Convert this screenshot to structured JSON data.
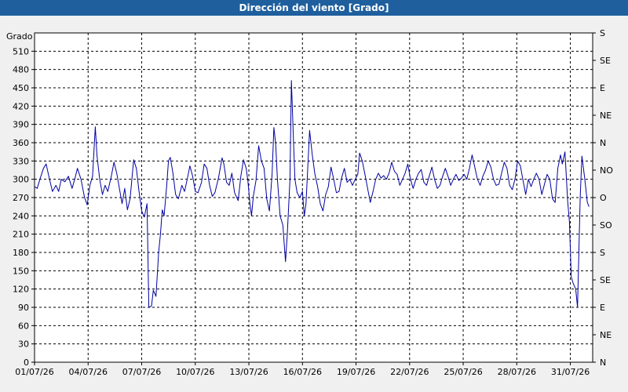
{
  "window": {
    "title": "Dirección del viento [Grado]"
  },
  "colors": {
    "title_bar": "#1f5f9e",
    "series": "#0000a0",
    "grid": "#000000",
    "background": "#ffffff"
  },
  "chart_data": {
    "type": "line",
    "title": "Dirección del viento [Grado]",
    "ylabel": "Grado",
    "xlim": [
      0,
      31.25
    ],
    "ylim": [
      0,
      540
    ],
    "x_ticks": [
      {
        "x": 0,
        "label": "01/07/26"
      },
      {
        "x": 3,
        "label": "04/07/26"
      },
      {
        "x": 6,
        "label": "07/07/26"
      },
      {
        "x": 9,
        "label": "10/07/26"
      },
      {
        "x": 12,
        "label": "13/07/26"
      },
      {
        "x": 15,
        "label": "16/07/26"
      },
      {
        "x": 18,
        "label": "19/07/26"
      },
      {
        "x": 21,
        "label": "22/07/26"
      },
      {
        "x": 24,
        "label": "25/07/26"
      },
      {
        "x": 27,
        "label": "28/07/26"
      },
      {
        "x": 30,
        "label": "31/07/26"
      }
    ],
    "y_ticks": [
      0,
      30,
      60,
      90,
      120,
      150,
      180,
      210,
      240,
      270,
      300,
      330,
      360,
      390,
      420,
      450,
      480,
      510
    ],
    "right_axis": [
      {
        "y": 540,
        "label": "S"
      },
      {
        "y": 495,
        "label": "SE"
      },
      {
        "y": 450,
        "label": "E"
      },
      {
        "y": 405,
        "label": "NE"
      },
      {
        "y": 360,
        "label": "N"
      },
      {
        "y": 315,
        "label": "NO"
      },
      {
        "y": 270,
        "label": "O"
      },
      {
        "y": 225,
        "label": "SO"
      },
      {
        "y": 180,
        "label": "S"
      },
      {
        "y": 135,
        "label": "SE"
      },
      {
        "y": 90,
        "label": "E"
      },
      {
        "y": 45,
        "label": "NE"
      },
      {
        "y": 0,
        "label": "N"
      }
    ],
    "grid": true,
    "series": [
      {
        "values": [
          [
            0,
            288
          ],
          [
            0.15,
            285
          ],
          [
            0.3,
            300
          ],
          [
            0.5,
            318
          ],
          [
            0.65,
            325
          ],
          [
            0.8,
            305
          ],
          [
            1.0,
            280
          ],
          [
            1.2,
            290
          ],
          [
            1.35,
            280
          ],
          [
            1.5,
            300
          ],
          [
            1.7,
            296
          ],
          [
            1.9,
            305
          ],
          [
            2.1,
            285
          ],
          [
            2.25,
            300
          ],
          [
            2.4,
            318
          ],
          [
            2.6,
            300
          ],
          [
            2.8,
            270
          ],
          [
            2.95,
            258
          ],
          [
            3.1,
            290
          ],
          [
            3.25,
            305
          ],
          [
            3.4,
            386
          ],
          [
            3.5,
            338
          ],
          [
            3.65,
            300
          ],
          [
            3.8,
            275
          ],
          [
            3.95,
            290
          ],
          [
            4.1,
            280
          ],
          [
            4.3,
            305
          ],
          [
            4.45,
            328
          ],
          [
            4.6,
            310
          ],
          [
            4.75,
            285
          ],
          [
            4.9,
            260
          ],
          [
            5.05,
            285
          ],
          [
            5.2,
            250
          ],
          [
            5.35,
            268
          ],
          [
            5.55,
            332
          ],
          [
            5.7,
            318
          ],
          [
            5.85,
            280
          ],
          [
            6.0,
            248
          ],
          [
            6.15,
            238
          ],
          [
            6.3,
            260
          ],
          [
            6.4,
            90
          ],
          [
            6.55,
            92
          ],
          [
            6.65,
            118
          ],
          [
            6.8,
            108
          ],
          [
            6.95,
            180
          ],
          [
            7.05,
            210
          ],
          [
            7.15,
            250
          ],
          [
            7.25,
            240
          ],
          [
            7.4,
            290
          ],
          [
            7.5,
            330
          ],
          [
            7.6,
            336
          ],
          [
            7.75,
            310
          ],
          [
            7.9,
            275
          ],
          [
            8.05,
            268
          ],
          [
            8.25,
            290
          ],
          [
            8.4,
            280
          ],
          [
            8.55,
            300
          ],
          [
            8.7,
            322
          ],
          [
            8.85,
            305
          ],
          [
            9.0,
            280
          ],
          [
            9.15,
            278
          ],
          [
            9.35,
            295
          ],
          [
            9.5,
            325
          ],
          [
            9.65,
            318
          ],
          [
            9.8,
            290
          ],
          [
            9.95,
            272
          ],
          [
            10.1,
            278
          ],
          [
            10.3,
            302
          ],
          [
            10.5,
            335
          ],
          [
            10.6,
            325
          ],
          [
            10.75,
            295
          ],
          [
            10.9,
            290
          ],
          [
            11.05,
            310
          ],
          [
            11.2,
            278
          ],
          [
            11.4,
            265
          ],
          [
            11.55,
            305
          ],
          [
            11.7,
            332
          ],
          [
            11.85,
            318
          ],
          [
            11.95,
            296
          ],
          [
            12.05,
            262
          ],
          [
            12.15,
            240
          ],
          [
            12.25,
            272
          ],
          [
            12.4,
            298
          ],
          [
            12.55,
            355
          ],
          [
            12.7,
            330
          ],
          [
            12.85,
            318
          ],
          [
            13.0,
            268
          ],
          [
            13.15,
            248
          ],
          [
            13.3,
            308
          ],
          [
            13.4,
            385
          ],
          [
            13.5,
            358
          ],
          [
            13.6,
            300
          ],
          [
            13.75,
            240
          ],
          [
            13.9,
            225
          ],
          [
            14.05,
            165
          ],
          [
            14.15,
            208
          ],
          [
            14.3,
            300
          ],
          [
            14.38,
            462
          ],
          [
            14.48,
            380
          ],
          [
            14.58,
            300
          ],
          [
            14.7,
            278
          ],
          [
            14.85,
            270
          ],
          [
            15.0,
            280
          ],
          [
            15.1,
            240
          ],
          [
            15.2,
            260
          ],
          [
            15.3,
            320
          ],
          [
            15.4,
            380
          ],
          [
            15.55,
            340
          ],
          [
            15.7,
            308
          ],
          [
            15.85,
            288
          ],
          [
            16.0,
            260
          ],
          [
            16.15,
            248
          ],
          [
            16.3,
            275
          ],
          [
            16.45,
            288
          ],
          [
            16.6,
            320
          ],
          [
            16.75,
            300
          ],
          [
            16.9,
            278
          ],
          [
            17.05,
            280
          ],
          [
            17.2,
            303
          ],
          [
            17.35,
            318
          ],
          [
            17.5,
            295
          ],
          [
            17.65,
            300
          ],
          [
            17.8,
            290
          ],
          [
            17.95,
            300
          ],
          [
            18.1,
            308
          ],
          [
            18.2,
            343
          ],
          [
            18.35,
            330
          ],
          [
            18.5,
            308
          ],
          [
            18.65,
            285
          ],
          [
            18.8,
            262
          ],
          [
            18.95,
            280
          ],
          [
            19.1,
            300
          ],
          [
            19.25,
            310
          ],
          [
            19.4,
            302
          ],
          [
            19.55,
            306
          ],
          [
            19.7,
            300
          ],
          [
            19.85,
            310
          ],
          [
            20.0,
            328
          ],
          [
            20.15,
            313
          ],
          [
            20.3,
            308
          ],
          [
            20.45,
            290
          ],
          [
            20.6,
            300
          ],
          [
            20.75,
            310
          ],
          [
            20.9,
            325
          ],
          [
            21.05,
            300
          ],
          [
            21.2,
            285
          ],
          [
            21.35,
            300
          ],
          [
            21.5,
            310
          ],
          [
            21.65,
            316
          ],
          [
            21.8,
            295
          ],
          [
            21.95,
            290
          ],
          [
            22.1,
            305
          ],
          [
            22.25,
            320
          ],
          [
            22.4,
            300
          ],
          [
            22.55,
            285
          ],
          [
            22.7,
            290
          ],
          [
            22.85,
            305
          ],
          [
            23.0,
            318
          ],
          [
            23.15,
            305
          ],
          [
            23.3,
            290
          ],
          [
            23.45,
            300
          ],
          [
            23.6,
            308
          ],
          [
            23.75,
            298
          ],
          [
            23.9,
            302
          ],
          [
            24.05,
            308
          ],
          [
            24.2,
            300
          ],
          [
            24.35,
            318
          ],
          [
            24.5,
            340
          ],
          [
            24.65,
            320
          ],
          [
            24.8,
            300
          ],
          [
            24.95,
            290
          ],
          [
            25.1,
            305
          ],
          [
            25.25,
            315
          ],
          [
            25.4,
            330
          ],
          [
            25.55,
            320
          ],
          [
            25.7,
            300
          ],
          [
            25.85,
            290
          ],
          [
            26.0,
            292
          ],
          [
            26.15,
            310
          ],
          [
            26.3,
            328
          ],
          [
            26.45,
            318
          ],
          [
            26.6,
            290
          ],
          [
            26.75,
            283
          ],
          [
            26.9,
            300
          ],
          [
            27.05,
            330
          ],
          [
            27.2,
            322
          ],
          [
            27.35,
            298
          ],
          [
            27.5,
            275
          ],
          [
            27.65,
            300
          ],
          [
            27.8,
            288
          ],
          [
            27.95,
            300
          ],
          [
            28.1,
            310
          ],
          [
            28.25,
            300
          ],
          [
            28.4,
            275
          ],
          [
            28.55,
            292
          ],
          [
            28.7,
            308
          ],
          [
            28.85,
            300
          ],
          [
            29.0,
            268
          ],
          [
            29.15,
            262
          ],
          [
            29.3,
            318
          ],
          [
            29.45,
            340
          ],
          [
            29.55,
            325
          ],
          [
            29.7,
            345
          ],
          [
            29.85,
            265
          ],
          [
            29.95,
            230
          ],
          [
            30.05,
            140
          ],
          [
            30.15,
            130
          ],
          [
            30.3,
            120
          ],
          [
            30.4,
            90
          ],
          [
            30.55,
            270
          ],
          [
            30.65,
            338
          ],
          [
            30.8,
            302
          ],
          [
            30.95,
            262
          ],
          [
            31.05,
            255
          ]
        ]
      }
    ]
  }
}
